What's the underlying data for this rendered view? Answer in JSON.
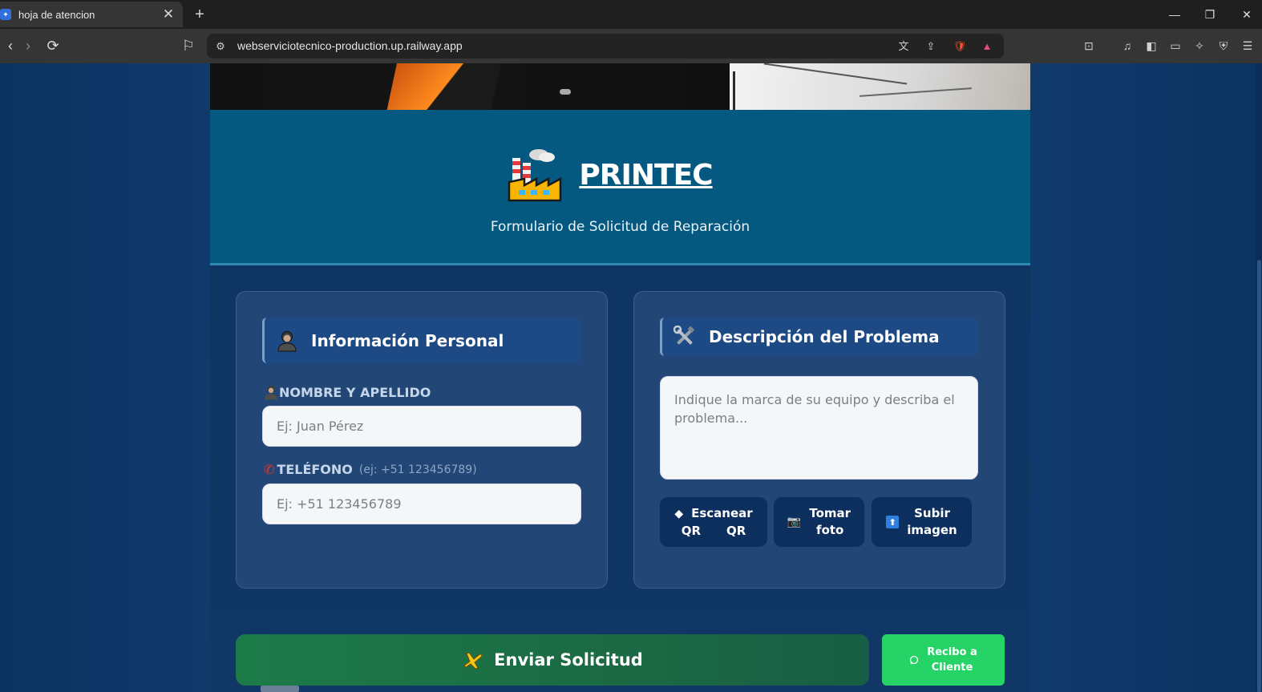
{
  "browser": {
    "tab_title": "hoja de atencion",
    "tab_close": "✕",
    "new_tab": "+",
    "url": "webserviciotecnico-production.up.railway.app",
    "window_controls": {
      "minimize": "—",
      "restore": "❐",
      "close": "✕"
    }
  },
  "header": {
    "brand": "PRINTEC",
    "subtitle": "Formulario de Solicitud de Reparación"
  },
  "personal_info": {
    "title": "Información Personal",
    "name_label": "NOMBRE Y APELLIDO",
    "name_placeholder": "Ej: Juan Pérez",
    "name_value": "",
    "phone_label": "TELÉFONO",
    "phone_hint": "(ej: +51 123456789)",
    "phone_placeholder": "Ej: +51 123456789",
    "phone_value": ""
  },
  "problem": {
    "title": "Descripción del Problema",
    "placeholder": "Indique la marca de su equipo y describa el problema...",
    "buttons": [
      {
        "label_line1": "Escanear",
        "label_line2": "QR",
        "prefix": "QR",
        "icon": "diamond-icon"
      },
      {
        "label_line1": "Tomar",
        "label_line2": "foto",
        "icon": "camera-icon"
      },
      {
        "label_line1": "Subir",
        "label_line2": "imagen",
        "icon": "upload-icon"
      }
    ]
  },
  "submit": {
    "label": "Enviar Solicitud"
  },
  "receipt": {
    "label_line1": "Recibo a",
    "label_line2": "Cliente"
  },
  "colors": {
    "header_bg": "#05587f",
    "section_head": "#1d4a85",
    "submit_green": "#1c7a48",
    "whatsapp_green": "#25d366",
    "page_bg": "#0e3566"
  }
}
